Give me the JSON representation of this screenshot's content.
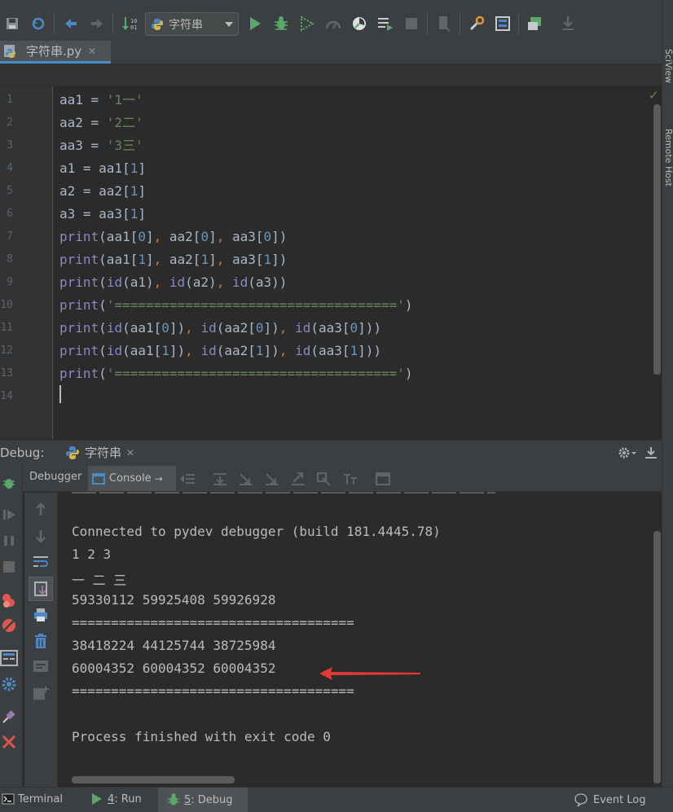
{
  "toolbar": {
    "run_config": "字符串"
  },
  "right_stripe": {
    "tool1": "SciView",
    "tool2": "Remote Host"
  },
  "editor": {
    "file_tab": "字符串.py",
    "line_numbers": [
      "1",
      "2",
      "3",
      "4",
      "5",
      "6",
      "7",
      "8",
      "9",
      "10",
      "11",
      "12",
      "13",
      "14"
    ]
  },
  "debug": {
    "label": "Debug:",
    "session_tab": "字符串",
    "tab_debugger": "Debugger",
    "tab_console": "Console",
    "console_lines": [
      "Connected to pydev debugger (build 181.4445.78)",
      "1 2 3",
      "一 二 三",
      "59330112 59925408 59926928",
      "====================================",
      "38418224 44125744 38725984",
      "60004352 60004352 60004352",
      "====================================",
      "",
      "Process finished with exit code 0"
    ]
  },
  "statusbar": {
    "terminal": "Terminal",
    "run_num": "4",
    "run_label": ": Run",
    "debug_num": "5",
    "debug_label": ": Debug",
    "event_log": "Event Log"
  },
  "colors": {
    "accent_red": "#e53935",
    "string_green": "#6a8759",
    "builtin_purple": "#8888c6",
    "number_blue": "#6897bb",
    "comma_orange": "#cc7832"
  }
}
